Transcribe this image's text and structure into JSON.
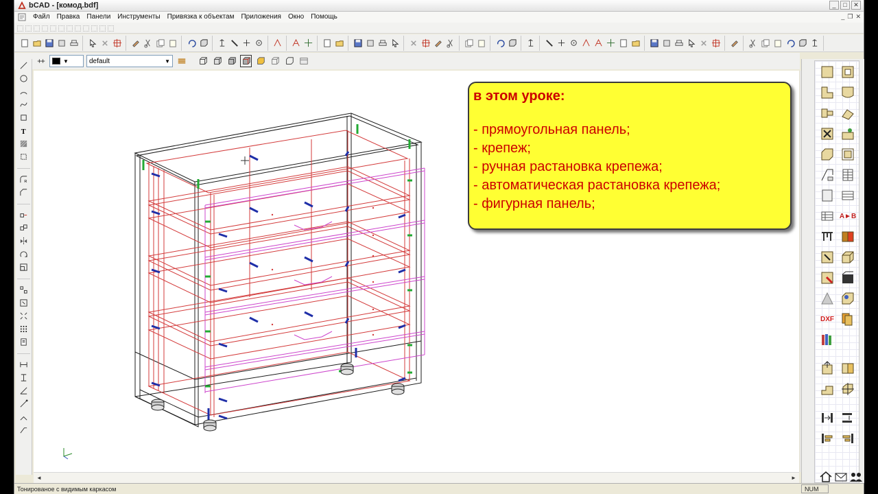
{
  "window": {
    "title": "bCAD - [комод.bdf]",
    "min_label": "_",
    "max_label": "□",
    "close_label": "✕"
  },
  "menu": {
    "items": [
      "Файл",
      "Правка",
      "Панели",
      "Инструменты",
      "Привязка к объектам",
      "Приложения",
      "Окно",
      "Помощь"
    ],
    "mdi_min": "_",
    "mdi_restore": "❐",
    "mdi_close": "✕"
  },
  "toolbar": {
    "color_swatch": "#000000",
    "layer_value": "default"
  },
  "callout": {
    "heading": "в этом уроке:",
    "items": [
      "- прямоугольная панель;",
      "- крепеж;",
      "- ручная растановка крепежа;",
      "- автоматическая растановка крепежа;",
      "- фигурная панель;"
    ],
    "text_color": "#cc0000",
    "background_color": "#ffff33"
  },
  "right_panel": {
    "ab_label": "A►B",
    "dxf_label": "DXF"
  },
  "status": {
    "mode_text": "Тонированое с видимым каркасом",
    "num_indicator": "NUM"
  },
  "colors": {
    "frame": "#1a1a1a",
    "panel_edges": "#d33a3a",
    "facade_edges": "#cc44cc",
    "fasteners_blue": "#1f2fa8",
    "fasteners_green": "#22aa33"
  }
}
